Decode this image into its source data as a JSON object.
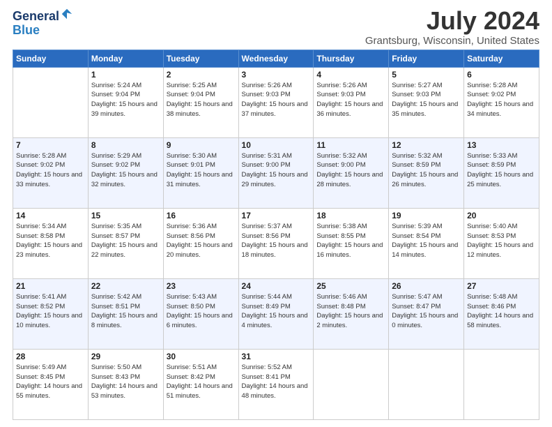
{
  "logo": {
    "line1": "General",
    "line2": "Blue"
  },
  "title": "July 2024",
  "location": "Grantsburg, Wisconsin, United States",
  "weekdays": [
    "Sunday",
    "Monday",
    "Tuesday",
    "Wednesday",
    "Thursday",
    "Friday",
    "Saturday"
  ],
  "weeks": [
    [
      {
        "day": "",
        "sunrise": "",
        "sunset": "",
        "daylight": ""
      },
      {
        "day": "1",
        "sunrise": "Sunrise: 5:24 AM",
        "sunset": "Sunset: 9:04 PM",
        "daylight": "Daylight: 15 hours and 39 minutes."
      },
      {
        "day": "2",
        "sunrise": "Sunrise: 5:25 AM",
        "sunset": "Sunset: 9:04 PM",
        "daylight": "Daylight: 15 hours and 38 minutes."
      },
      {
        "day": "3",
        "sunrise": "Sunrise: 5:26 AM",
        "sunset": "Sunset: 9:03 PM",
        "daylight": "Daylight: 15 hours and 37 minutes."
      },
      {
        "day": "4",
        "sunrise": "Sunrise: 5:26 AM",
        "sunset": "Sunset: 9:03 PM",
        "daylight": "Daylight: 15 hours and 36 minutes."
      },
      {
        "day": "5",
        "sunrise": "Sunrise: 5:27 AM",
        "sunset": "Sunset: 9:03 PM",
        "daylight": "Daylight: 15 hours and 35 minutes."
      },
      {
        "day": "6",
        "sunrise": "Sunrise: 5:28 AM",
        "sunset": "Sunset: 9:02 PM",
        "daylight": "Daylight: 15 hours and 34 minutes."
      }
    ],
    [
      {
        "day": "7",
        "sunrise": "Sunrise: 5:28 AM",
        "sunset": "Sunset: 9:02 PM",
        "daylight": "Daylight: 15 hours and 33 minutes."
      },
      {
        "day": "8",
        "sunrise": "Sunrise: 5:29 AM",
        "sunset": "Sunset: 9:02 PM",
        "daylight": "Daylight: 15 hours and 32 minutes."
      },
      {
        "day": "9",
        "sunrise": "Sunrise: 5:30 AM",
        "sunset": "Sunset: 9:01 PM",
        "daylight": "Daylight: 15 hours and 31 minutes."
      },
      {
        "day": "10",
        "sunrise": "Sunrise: 5:31 AM",
        "sunset": "Sunset: 9:00 PM",
        "daylight": "Daylight: 15 hours and 29 minutes."
      },
      {
        "day": "11",
        "sunrise": "Sunrise: 5:32 AM",
        "sunset": "Sunset: 9:00 PM",
        "daylight": "Daylight: 15 hours and 28 minutes."
      },
      {
        "day": "12",
        "sunrise": "Sunrise: 5:32 AM",
        "sunset": "Sunset: 8:59 PM",
        "daylight": "Daylight: 15 hours and 26 minutes."
      },
      {
        "day": "13",
        "sunrise": "Sunrise: 5:33 AM",
        "sunset": "Sunset: 8:59 PM",
        "daylight": "Daylight: 15 hours and 25 minutes."
      }
    ],
    [
      {
        "day": "14",
        "sunrise": "Sunrise: 5:34 AM",
        "sunset": "Sunset: 8:58 PM",
        "daylight": "Daylight: 15 hours and 23 minutes."
      },
      {
        "day": "15",
        "sunrise": "Sunrise: 5:35 AM",
        "sunset": "Sunset: 8:57 PM",
        "daylight": "Daylight: 15 hours and 22 minutes."
      },
      {
        "day": "16",
        "sunrise": "Sunrise: 5:36 AM",
        "sunset": "Sunset: 8:56 PM",
        "daylight": "Daylight: 15 hours and 20 minutes."
      },
      {
        "day": "17",
        "sunrise": "Sunrise: 5:37 AM",
        "sunset": "Sunset: 8:56 PM",
        "daylight": "Daylight: 15 hours and 18 minutes."
      },
      {
        "day": "18",
        "sunrise": "Sunrise: 5:38 AM",
        "sunset": "Sunset: 8:55 PM",
        "daylight": "Daylight: 15 hours and 16 minutes."
      },
      {
        "day": "19",
        "sunrise": "Sunrise: 5:39 AM",
        "sunset": "Sunset: 8:54 PM",
        "daylight": "Daylight: 15 hours and 14 minutes."
      },
      {
        "day": "20",
        "sunrise": "Sunrise: 5:40 AM",
        "sunset": "Sunset: 8:53 PM",
        "daylight": "Daylight: 15 hours and 12 minutes."
      }
    ],
    [
      {
        "day": "21",
        "sunrise": "Sunrise: 5:41 AM",
        "sunset": "Sunset: 8:52 PM",
        "daylight": "Daylight: 15 hours and 10 minutes."
      },
      {
        "day": "22",
        "sunrise": "Sunrise: 5:42 AM",
        "sunset": "Sunset: 8:51 PM",
        "daylight": "Daylight: 15 hours and 8 minutes."
      },
      {
        "day": "23",
        "sunrise": "Sunrise: 5:43 AM",
        "sunset": "Sunset: 8:50 PM",
        "daylight": "Daylight: 15 hours and 6 minutes."
      },
      {
        "day": "24",
        "sunrise": "Sunrise: 5:44 AM",
        "sunset": "Sunset: 8:49 PM",
        "daylight": "Daylight: 15 hours and 4 minutes."
      },
      {
        "day": "25",
        "sunrise": "Sunrise: 5:46 AM",
        "sunset": "Sunset: 8:48 PM",
        "daylight": "Daylight: 15 hours and 2 minutes."
      },
      {
        "day": "26",
        "sunrise": "Sunrise: 5:47 AM",
        "sunset": "Sunset: 8:47 PM",
        "daylight": "Daylight: 15 hours and 0 minutes."
      },
      {
        "day": "27",
        "sunrise": "Sunrise: 5:48 AM",
        "sunset": "Sunset: 8:46 PM",
        "daylight": "Daylight: 14 hours and 58 minutes."
      }
    ],
    [
      {
        "day": "28",
        "sunrise": "Sunrise: 5:49 AM",
        "sunset": "Sunset: 8:45 PM",
        "daylight": "Daylight: 14 hours and 55 minutes."
      },
      {
        "day": "29",
        "sunrise": "Sunrise: 5:50 AM",
        "sunset": "Sunset: 8:43 PM",
        "daylight": "Daylight: 14 hours and 53 minutes."
      },
      {
        "day": "30",
        "sunrise": "Sunrise: 5:51 AM",
        "sunset": "Sunset: 8:42 PM",
        "daylight": "Daylight: 14 hours and 51 minutes."
      },
      {
        "day": "31",
        "sunrise": "Sunrise: 5:52 AM",
        "sunset": "Sunset: 8:41 PM",
        "daylight": "Daylight: 14 hours and 48 minutes."
      },
      {
        "day": "",
        "sunrise": "",
        "sunset": "",
        "daylight": ""
      },
      {
        "day": "",
        "sunrise": "",
        "sunset": "",
        "daylight": ""
      },
      {
        "day": "",
        "sunrise": "",
        "sunset": "",
        "daylight": ""
      }
    ]
  ]
}
